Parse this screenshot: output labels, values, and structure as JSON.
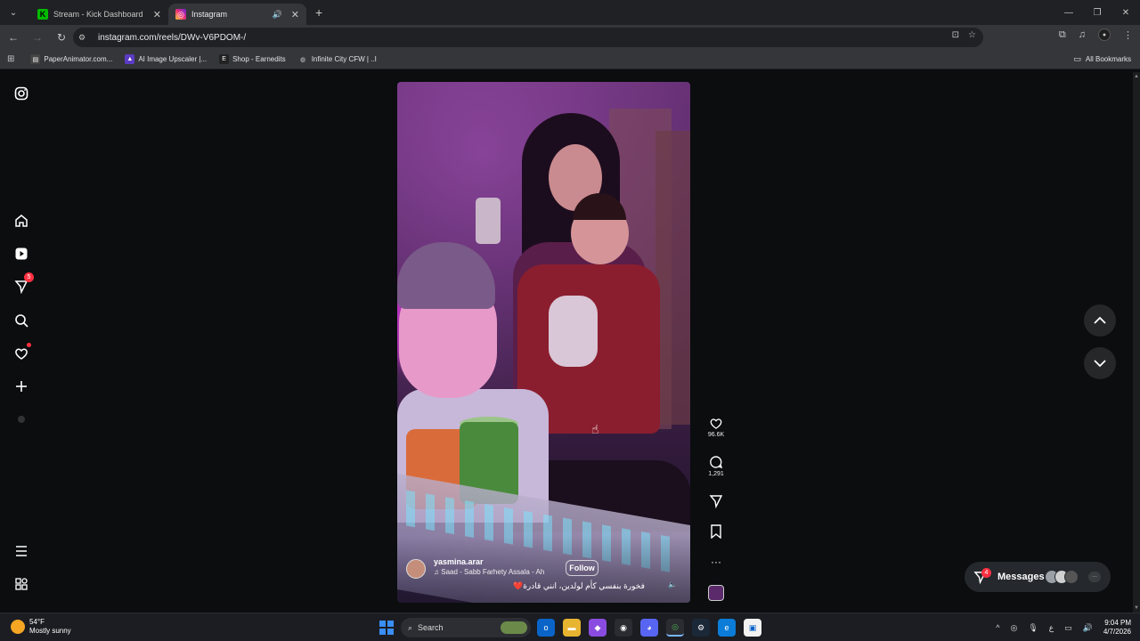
{
  "browser": {
    "tabs": [
      {
        "title": "Stream - Kick Dashboard",
        "icon": "kick-icon",
        "active": false
      },
      {
        "title": "Instagram",
        "icon": "instagram-icon",
        "active": true,
        "audio": true
      }
    ],
    "url": "instagram.com/reels/DWv-V6PDOM-/",
    "bookmarks": [
      {
        "label": "PaperAnimator.com..."
      },
      {
        "label": "AI Image Upscaler |..."
      },
      {
        "label": "Shop - Earnedits"
      },
      {
        "label": "Infinite City CFW | ..I"
      }
    ],
    "all_bookmarks": "All Bookmarks"
  },
  "sidebar": {
    "notifications_badge": "5"
  },
  "reel": {
    "author": "yasmina.arar",
    "music": "Saad - Sabb Farhety  Assala - Ah",
    "follow_label": "Follow",
    "caption": "فخورة بنفسي كأم لولدين، انني قادرة❤️",
    "likes": "96.6K",
    "comments": "1,291"
  },
  "messages": {
    "label": "Messages",
    "badge": "4",
    "more": "···"
  },
  "taskbar": {
    "temp": "54°F",
    "weather": "Mostly sunny",
    "search": "Search",
    "time": "9:04 PM",
    "date": "4/7/2026"
  },
  "colors": {
    "accent_red": "#ff3040",
    "background": "#0b0d0f"
  }
}
